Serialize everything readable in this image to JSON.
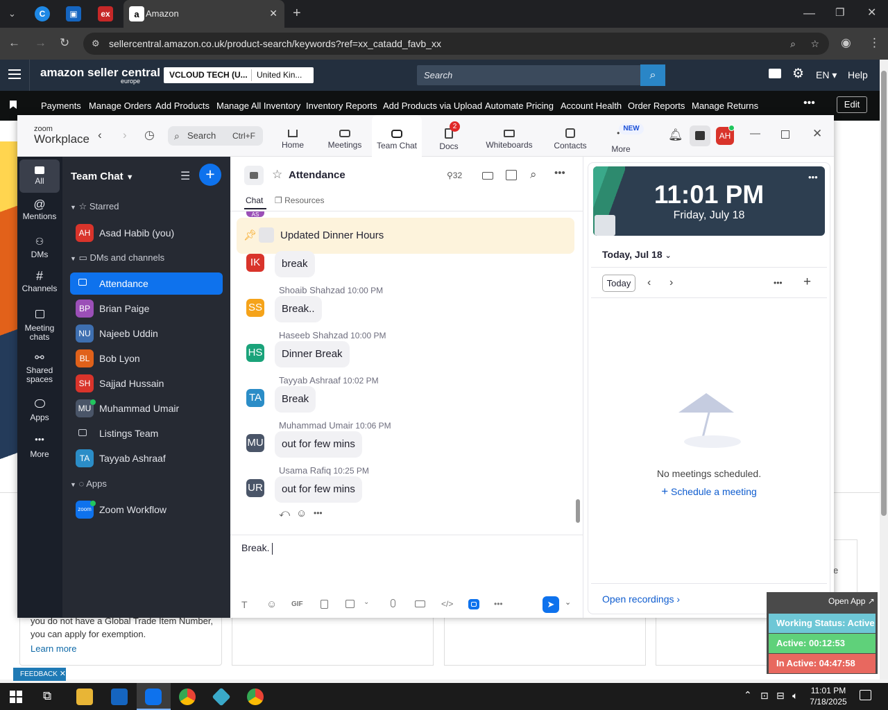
{
  "browser": {
    "tab_title": "Amazon",
    "url": "sellercentral.amazon.co.uk/product-search/keywords?ref=xx_catadd_favb_xx"
  },
  "seller_central": {
    "logo_text": "amazon seller central",
    "logo_sub": "europe",
    "account": "VCLOUD TECH (U...",
    "marketplace": "United Kin...",
    "search_placeholder": "Search",
    "lang": "EN",
    "help": "Help",
    "edit": "Edit",
    "nav": [
      "Payments",
      "Manage Orders",
      "Add Products",
      "Manage All Inventory",
      "Inventory Reports",
      "Add Products via Upload",
      "Automate Pricing",
      "Account Health",
      "Order Reports",
      "Manage Returns"
    ],
    "bg_text_1": "you do not have a Global Trade Item Number,",
    "bg_text_2": "you can apply for exemption.",
    "learn_more": "Learn more",
    "feedback": "FEEDBACK",
    "bg_right_text": "e"
  },
  "zoom": {
    "brand_small": "zoom",
    "brand": "Workplace",
    "search_label": "Search",
    "search_shortcut": "Ctrl+F",
    "tabs": [
      {
        "label": "Home"
      },
      {
        "label": "Meetings"
      },
      {
        "label": "Team Chat"
      },
      {
        "label": "Docs",
        "badge": "2"
      },
      {
        "label": "Whiteboards"
      },
      {
        "label": "Contacts"
      },
      {
        "label": "More",
        "badge": "NEW"
      }
    ],
    "user_initials": "AH",
    "rail": [
      {
        "label": "All"
      },
      {
        "label": "Mentions"
      },
      {
        "label": "DMs"
      },
      {
        "label": "Channels"
      },
      {
        "label": "Meeting",
        "label2": "chats"
      },
      {
        "label": "Shared",
        "label2": "spaces"
      },
      {
        "label": "Apps"
      },
      {
        "label": "More"
      }
    ],
    "sidebar": {
      "title": "Team Chat",
      "sections": {
        "starred": "Starred",
        "dms": "DMs and channels",
        "apps": "Apps"
      },
      "starred_user": {
        "initials": "AH",
        "name": "Asad Habib (you)"
      },
      "items": [
        {
          "name": "Attendance",
          "initials": "",
          "color": "#0e72ed"
        },
        {
          "name": "Brian Paige",
          "initials": "BP",
          "color": "#9b4fb7"
        },
        {
          "name": "Najeeb Uddin",
          "initials": "NU",
          "color": "#3e6fb0"
        },
        {
          "name": "Bob Lyon",
          "initials": "BL",
          "color": "#e0611a"
        },
        {
          "name": "Sajjad Hussain",
          "initials": "SH",
          "color": "#d9342b"
        },
        {
          "name": "Muhammad Umair",
          "initials": "MU",
          "color": "#4a5568"
        },
        {
          "name": "Listings Team",
          "initials": "",
          "color": ""
        },
        {
          "name": "Tayyab Ashraaf",
          "initials": "TA",
          "color": "#2b8dc7"
        }
      ],
      "app_item": {
        "name": "Zoom Workflow",
        "icon_text": "zoom"
      }
    },
    "chat": {
      "channel": "Attendance",
      "members": "32",
      "tabs": {
        "chat": "Chat",
        "resources": "Resources"
      },
      "pinned": "Updated Dinner Hours",
      "partial_avatar": "AS",
      "first_bubble": {
        "initials": "IK",
        "color": "#d9342b",
        "text": "break"
      },
      "messages": [
        {
          "initials": "SS",
          "color": "#f5a31a",
          "name": "Shoaib Shahzad",
          "time": "10:00 PM",
          "text": "Break.."
        },
        {
          "initials": "HS",
          "color": "#1aa37a",
          "name": "Haseeb Shahzad",
          "time": "10:00 PM",
          "text": "Dinner Break"
        },
        {
          "initials": "TA",
          "color": "#2b8dc7",
          "name": "Tayyab Ashraaf",
          "time": "10:02 PM",
          "text": "Break"
        },
        {
          "initials": "MU",
          "color": "#4a5568",
          "name": "Muhammad Umair",
          "time": "10:06 PM",
          "text": "out for few mins"
        },
        {
          "initials": "UR",
          "color": "#4a5568",
          "name": "Usama Rafiq",
          "time": "10:25 PM",
          "text": "out for few mins"
        }
      ],
      "composer_text": "Break."
    },
    "calendar": {
      "time": "11:01 PM",
      "date": "Friday, July 18",
      "today_label": "Today, Jul 18",
      "today_button": "Today",
      "empty": "No meetings scheduled.",
      "schedule": "Schedule a meeting",
      "open_recordings": "Open recordings"
    }
  },
  "status_widget": {
    "open_app": "Open App",
    "working": "Working Status: Active",
    "active": "Active: 00:12:53",
    "inactive": "In Active: 04:47:58"
  },
  "taskbar": {
    "time": "11:01 PM",
    "date": "7/18/2025"
  }
}
